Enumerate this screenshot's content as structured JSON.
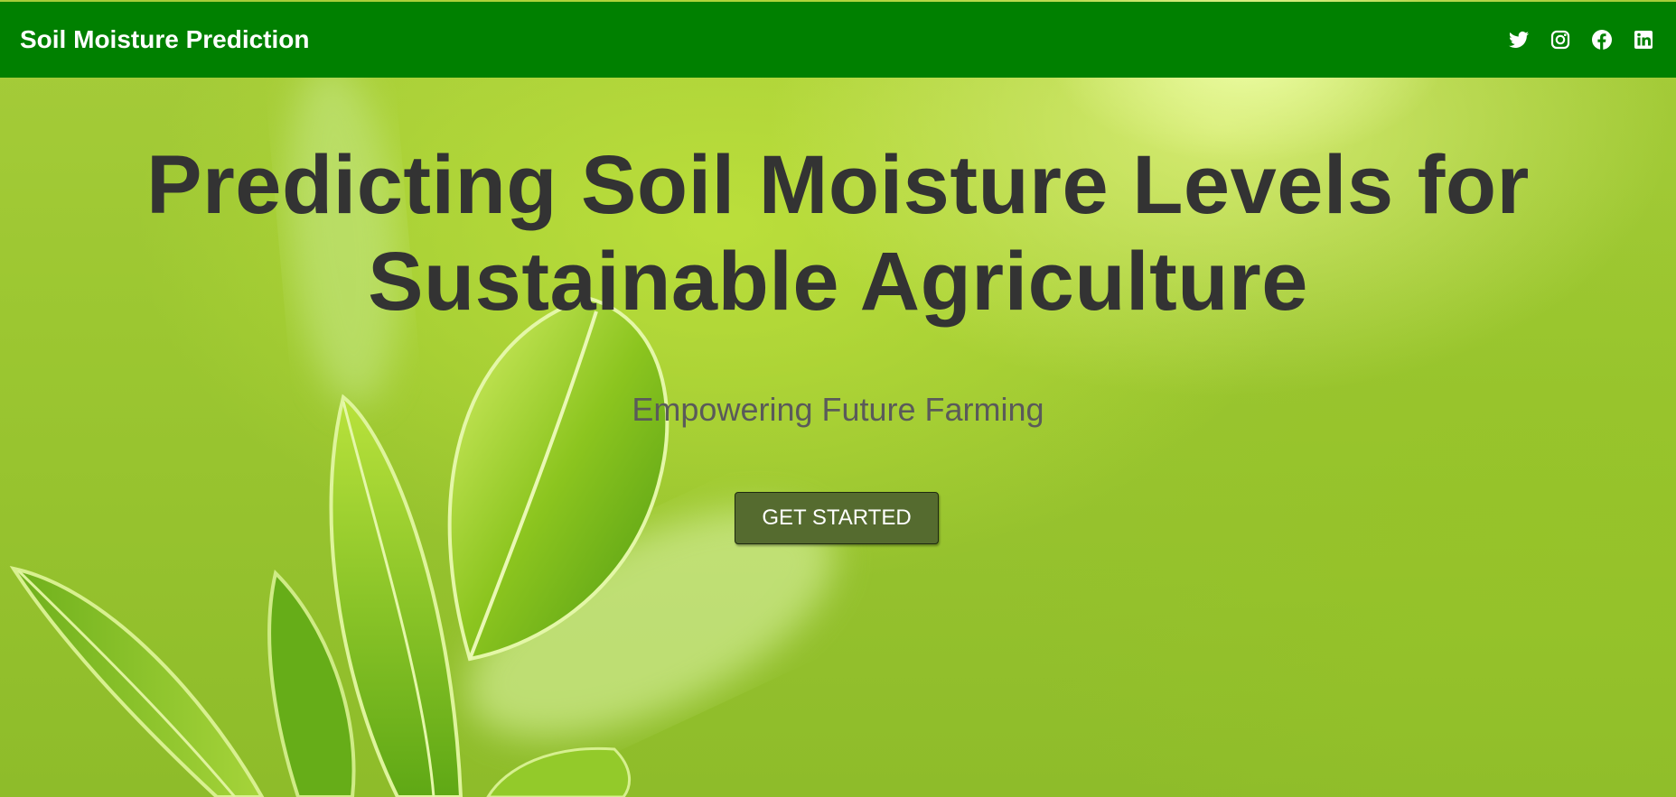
{
  "navbar": {
    "brand": "Soil Moisture Prediction",
    "social_links": [
      {
        "icon": "twitter-icon"
      },
      {
        "icon": "instagram-icon"
      },
      {
        "icon": "facebook-icon"
      },
      {
        "icon": "linkedin-icon"
      }
    ],
    "background_color": "#008000"
  },
  "hero": {
    "headline_line1": "Predicting Soil Moisture Levels for",
    "headline_line2": "Sustainable Agriculture",
    "tagline": "Empowering Future Farming",
    "cta_label": "GET STARTED",
    "cta_color": "#556B2F",
    "background": "green-leaves-image"
  }
}
